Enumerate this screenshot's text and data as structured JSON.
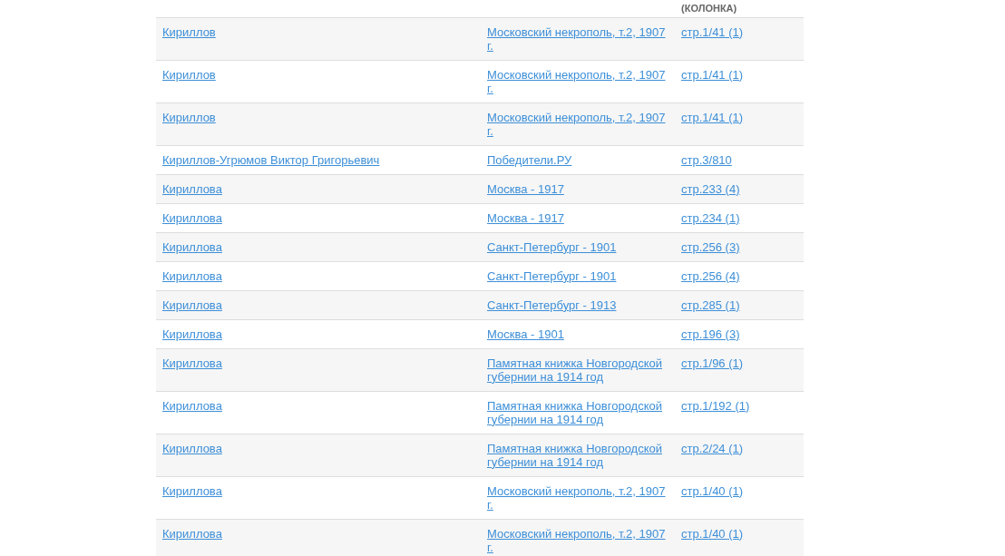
{
  "table": {
    "columns": [
      {},
      {},
      {
        "header": "(КОЛОНКА)"
      }
    ],
    "rows": [
      {
        "name": "Кириллов",
        "source": "Московский некрополь, т.2, 1907 г.",
        "page": "стр.1/41 (1)"
      },
      {
        "name": "Кириллов",
        "source": "Московский некрополь, т.2, 1907 г.",
        "page": "стр.1/41 (1)"
      },
      {
        "name": "Кириллов",
        "source": "Московский некрополь, т.2, 1907 г.",
        "page": "стр.1/41 (1)"
      },
      {
        "name": "Кириллов-Угрюмов Виктор Григорьевич",
        "source": "Победители.РУ",
        "page": "стр.3/810"
      },
      {
        "name": "Кириллова",
        "source": "Москва - 1917",
        "page": "стр.233 (4)"
      },
      {
        "name": "Кириллова",
        "source": "Москва - 1917",
        "page": "стр.234 (1)"
      },
      {
        "name": "Кириллова",
        "source": "Санкт-Петербург - 1901",
        "page": "стр.256 (3)"
      },
      {
        "name": "Кириллова",
        "source": "Санкт-Петербург - 1901",
        "page": "стр.256 (4)"
      },
      {
        "name": "Кириллова",
        "source": "Санкт-Петербург - 1913",
        "page": "стр.285 (1)"
      },
      {
        "name": "Кириллова",
        "source": "Москва - 1901",
        "page": "стр.196 (3)"
      },
      {
        "name": "Кириллова",
        "source": "Памятная книжка Новгородской губернии на 1914 год",
        "page": "стр.1/96 (1)"
      },
      {
        "name": "Кириллова",
        "source": "Памятная книжка Новгородской губернии на 1914 год",
        "page": "стр.1/192 (1)"
      },
      {
        "name": "Кириллова",
        "source": "Памятная книжка Новгородской губернии на 1914 год",
        "page": "стр.2/24 (1)"
      },
      {
        "name": "Кириллова",
        "source": "Московский некрополь, т.2, 1907 г.",
        "page": "стр.1/40 (1)"
      },
      {
        "name": "Кириллова",
        "source": "Московский некрополь, т.2, 1907 г.",
        "page": "стр.1/40 (1)"
      }
    ]
  }
}
